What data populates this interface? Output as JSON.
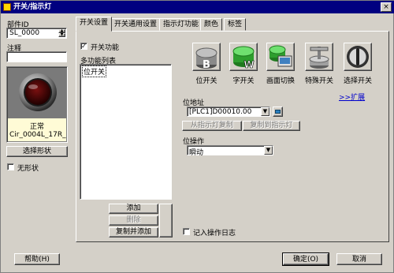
{
  "window": {
    "title": "开关/指示灯"
  },
  "left": {
    "part_id_label": "部件ID",
    "part_id_value": "SL_0000",
    "comment_label": "注释",
    "comment_value": "",
    "preview_state": "正常",
    "preview_shape_name": "Cir_0004L_17R_...",
    "select_shape_button": "选择形状",
    "no_shape_label": "无形状",
    "help_button": "帮助(H)"
  },
  "tabs": [
    {
      "label": "开关设置"
    },
    {
      "label": "开关通用设置"
    },
    {
      "label": "指示灯功能"
    },
    {
      "label": "颜色"
    },
    {
      "label": "标签"
    }
  ],
  "switch_settings": {
    "switch_function_label": "开关功能",
    "switch_function_checked": true,
    "multi_function_list_label": "多功能列表",
    "list_items": [
      "位开关"
    ],
    "add_button": "添加",
    "delete_button": "删除",
    "copy_add_button": "复制并添加",
    "icons": [
      {
        "name": "bit-switch-icon",
        "label": "位开关"
      },
      {
        "name": "word-switch-icon",
        "label": "字开关"
      },
      {
        "name": "screen-change-icon",
        "label": "画面切换"
      },
      {
        "name": "special-switch-icon",
        "label": "特殊开关"
      },
      {
        "name": "selector-switch-icon",
        "label": "选择开关"
      }
    ],
    "expand_link": ">>扩展",
    "bit_address_label": "位地址",
    "bit_address_value": "[PLC1]D00010.00",
    "copy_from_indicator_button": "从指示灯复制",
    "copy_to_indicator_button": "复制到指示灯",
    "bit_action_label": "位操作",
    "bit_action_value": "瞬动",
    "log_checkbox_label": "记入操作日志",
    "log_checked": false
  },
  "footer": {
    "ok_button": "确定(O)",
    "cancel_button": "取消"
  },
  "colors": {
    "titlebar": "#000080",
    "face": "#d4d0c8",
    "preview_bg": "#fffbd6"
  }
}
